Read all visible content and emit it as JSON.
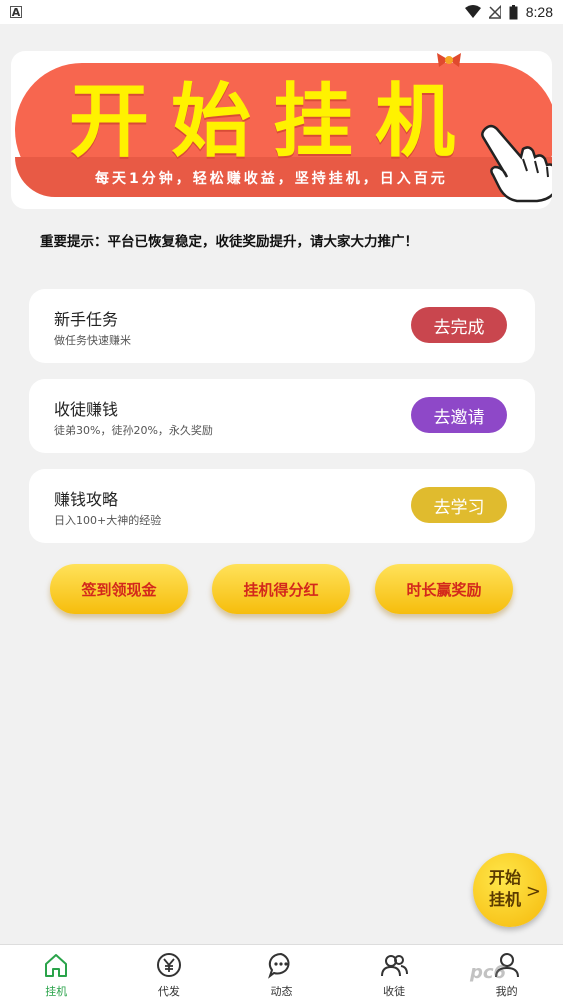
{
  "status_bar": {
    "time": "8:28",
    "left_icon": "a-box-icon"
  },
  "banner": {
    "title": "开始挂机",
    "subtitle": "每天1分钟，轻松赚收益，坚持挂机，日入百元"
  },
  "notice": "重要提示：平台已恢复稳定，收徒奖励提升，请大家大力推广！",
  "tasks": [
    {
      "title": "新手任务",
      "desc": "做任务快速赚米",
      "button": "去完成",
      "color": "#c9464e"
    },
    {
      "title": "收徒赚钱",
      "desc": "徒弟30%，徒孙20%，永久奖励",
      "button": "去邀请",
      "color": "#8e48c8"
    },
    {
      "title": "赚钱攻略",
      "desc": "日入100+大神的经验",
      "button": "去学习",
      "color": "#e0bb2e"
    }
  ],
  "gold_buttons": [
    "签到领现金",
    "挂机得分红",
    "时长赢奖励"
  ],
  "float_button": {
    "label": "开始挂机",
    "arrow": ">"
  },
  "nav": [
    {
      "label": "挂机",
      "icon": "home-icon"
    },
    {
      "label": "代发",
      "icon": "yuan-coin-icon"
    },
    {
      "label": "动态",
      "icon": "chat-bubble-icon"
    },
    {
      "label": "收徒",
      "icon": "users-icon"
    },
    {
      "label": "我的",
      "icon": "user-icon"
    }
  ],
  "watermark": "pc6",
  "colors": {
    "active_nav": "#2aa34a",
    "banner_bg": "#f7664f",
    "banner_text": "#fff200"
  }
}
